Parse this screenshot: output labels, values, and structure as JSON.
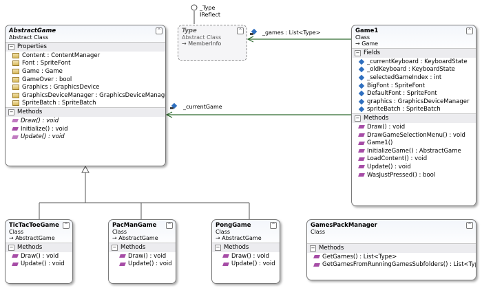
{
  "lollipop": {
    "type_label": "_Type",
    "interface_label": "IReflect"
  },
  "associations": {
    "games_label": "_games : List<Type>",
    "current_game_label": "_currentGame"
  },
  "abstract_game": {
    "name": "AbstractGame",
    "stereotype": "Abstract Class",
    "sections": {
      "properties_title": "Properties",
      "properties": [
        "Content : ContentManager",
        "Font : SpriteFont",
        "Game : Game",
        "GameOver : bool",
        "Graphics : GraphicsDevice",
        "GraphicsDeviceManager : GraphicsDeviceManager",
        "SpriteBatch : SpriteBatch"
      ],
      "methods_title": "Methods",
      "methods": [
        "Draw() : void",
        "Initialize() : void",
        "Update() : void"
      ]
    }
  },
  "type_box": {
    "name": "Type",
    "stereotype": "Abstract Class",
    "inherit": "→ MemberInfo"
  },
  "game1": {
    "name": "Game1",
    "stereotype": "Class",
    "inherit": "→ Game",
    "fields_title": "Fields",
    "fields": [
      "_currentKeyboard : KeyboardState",
      "_oldKeyboard : KeyboardState",
      "_selectedGameIndex : int",
      "BigFont : SpriteFont",
      "DefaultFont : SpriteFont",
      "graphics : GraphicsDeviceManager",
      "spriteBatch : SpriteBatch"
    ],
    "methods_title": "Methods",
    "methods": [
      "Draw() : void",
      "DrawGameSelectionMenu() : void",
      "Game1()",
      "InitializeGame() : AbstractGame",
      "LoadContent() : void",
      "Update() : void",
      "WasJustPressed() : bool"
    ]
  },
  "tictactoe": {
    "name": "TicTacToeGame",
    "stereotype": "Class",
    "inherit": "→ AbstractGame",
    "methods_title": "Methods",
    "methods": [
      "Draw() : void",
      "Update() : void"
    ]
  },
  "pacman": {
    "name": "PacManGame",
    "stereotype": "Class",
    "inherit": "→ AbstractGame",
    "methods_title": "Methods",
    "methods": [
      "Draw() : void",
      "Update() : void"
    ]
  },
  "pong": {
    "name": "PongGame",
    "stereotype": "Class",
    "inherit": "→ AbstractGame",
    "methods_title": "Methods",
    "methods": [
      "Draw() : void",
      "Update() : void"
    ]
  },
  "gamespack": {
    "name": "GamesPackManager",
    "stereotype": "Class",
    "methods_title": "Methods",
    "methods": [
      "GetGames() : List<Type>",
      "GetGamesFromRunningGamesSubfolders() : List<Type>"
    ]
  },
  "collapse_glyph": "^",
  "minus_glyph": "−"
}
